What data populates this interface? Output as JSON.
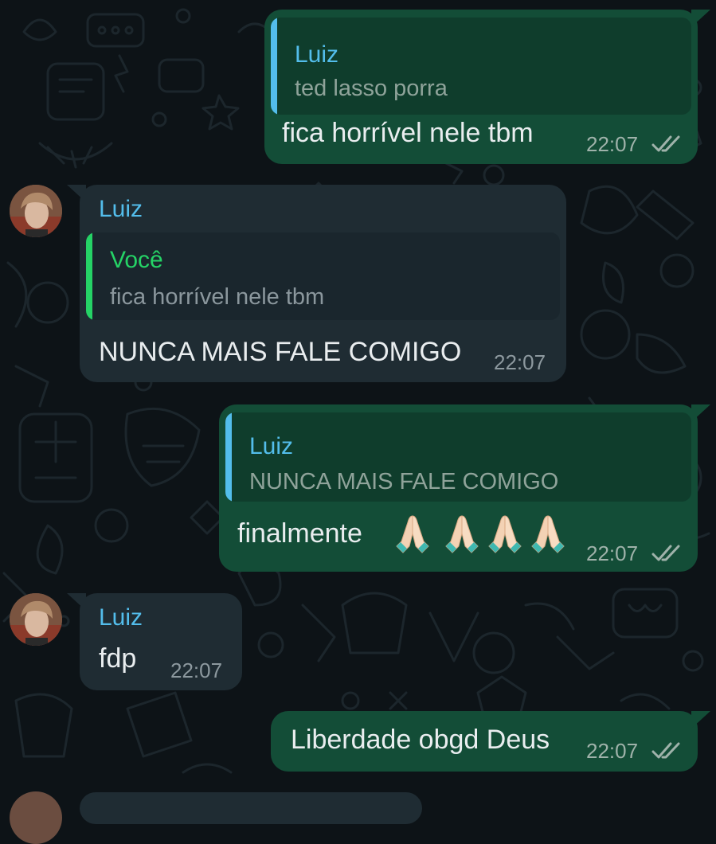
{
  "colors": {
    "background": "#0d1317",
    "outgoing_bubble": "#134d37",
    "incoming_bubble": "#1f2c33",
    "quote_author_contact": "#53bdeb",
    "quote_author_self": "#25d366",
    "read_ticks": "#9fb2aa"
  },
  "messages": [
    {
      "direction": "outgoing",
      "quote": {
        "author": "Luiz",
        "text": "ted lasso porra"
      },
      "text": "fica horrível nele tbm",
      "time": "22:07",
      "status_icon": "double-check-icon"
    },
    {
      "direction": "incoming",
      "sender": "Luiz",
      "quote": {
        "author": "Você",
        "text": "fica horrível nele tbm"
      },
      "text": "NUNCA MAIS FALE COMIGO",
      "time": "22:07"
    },
    {
      "direction": "outgoing",
      "quote": {
        "author": "Luiz",
        "text": "NUNCA MAIS FALE COMIGO"
      },
      "text": "finalmente",
      "emoji": [
        "folded-hands-emoji",
        "folded-hands-emoji",
        "folded-hands-emoji",
        "folded-hands-emoji"
      ],
      "time": "22:07",
      "status_icon": "double-check-icon"
    },
    {
      "direction": "incoming",
      "sender": "Luiz",
      "text": "fdp",
      "time": "22:07"
    },
    {
      "direction": "outgoing",
      "text": "Liberdade obgd Deus",
      "time": "22:07",
      "status_icon": "double-check-icon"
    }
  ]
}
